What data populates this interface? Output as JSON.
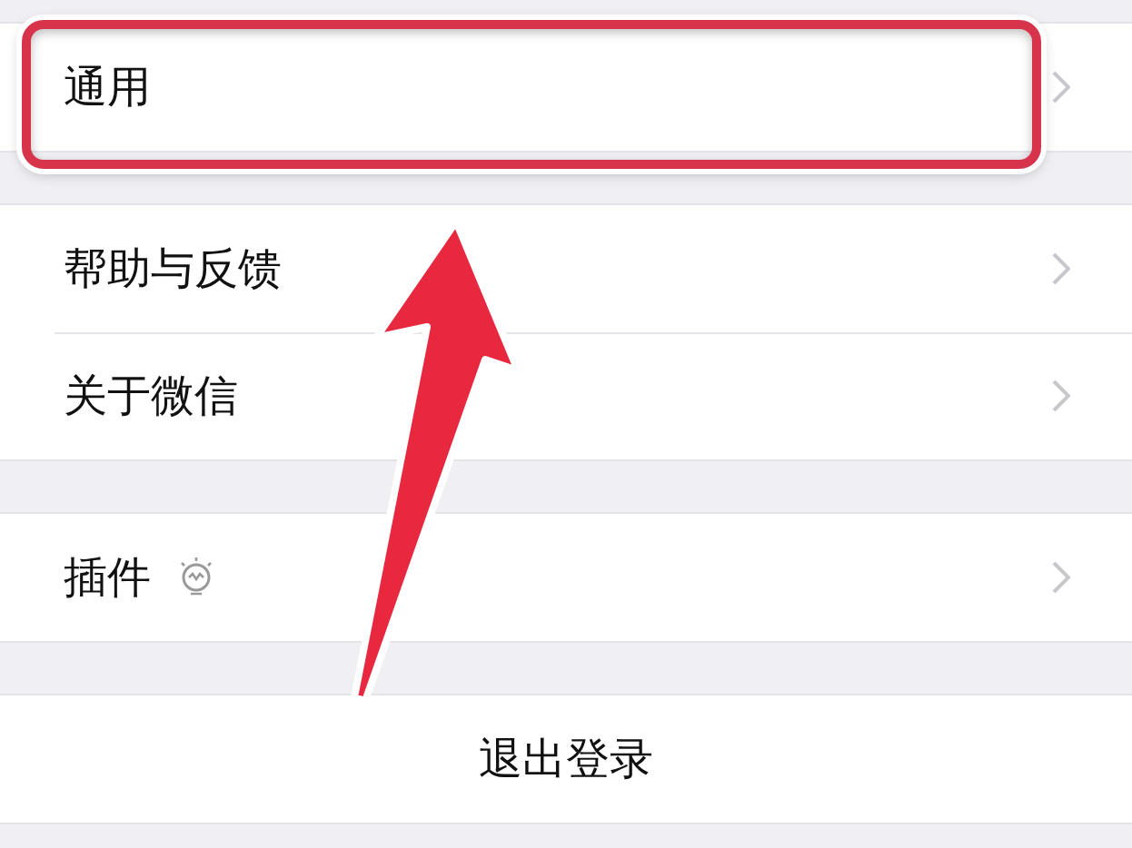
{
  "sections": [
    {
      "rows": [
        {
          "label": "通用",
          "kind": "item",
          "highlighted": true,
          "has_icon": false
        }
      ]
    },
    {
      "rows": [
        {
          "label": "帮助与反馈",
          "kind": "item",
          "highlighted": false,
          "has_icon": false
        },
        {
          "label": "关于微信",
          "kind": "item",
          "highlighted": false,
          "has_icon": false
        }
      ]
    },
    {
      "rows": [
        {
          "label": "插件",
          "kind": "item",
          "highlighted": false,
          "has_icon": true
        }
      ]
    },
    {
      "rows": [
        {
          "label": "退出登录",
          "kind": "action",
          "highlighted": false,
          "has_icon": false
        }
      ]
    }
  ]
}
